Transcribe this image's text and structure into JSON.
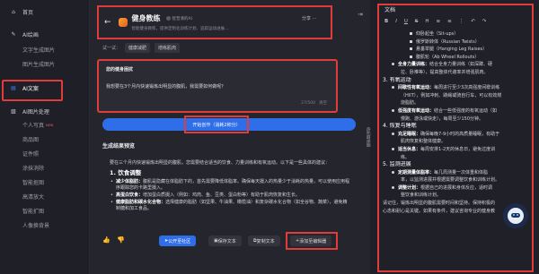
{
  "sidebar": {
    "items": [
      {
        "label": "首页",
        "icon": "home-icon",
        "sub": false
      },
      {
        "label": "AI绘画",
        "icon": "paint-icon",
        "sub": false
      },
      {
        "label": "文字生成图片",
        "sub": true
      },
      {
        "label": "图片生成图片",
        "sub": true
      },
      {
        "label": "AI文案",
        "icon": "document-icon",
        "sub": false,
        "active": true
      },
      {
        "label": "AI图片处理",
        "icon": "image-icon",
        "sub": false
      },
      {
        "label": "个人写真",
        "sub": true,
        "badge": "NEW"
      },
      {
        "label": "商品图",
        "sub": true
      },
      {
        "label": "证件照",
        "sub": true
      },
      {
        "label": "涂抹消除",
        "sub": true
      },
      {
        "label": "智能抠图",
        "sub": true
      },
      {
        "label": "高清放大",
        "sub": true
      },
      {
        "label": "智能扩图",
        "sub": true
      },
      {
        "label": "人像换背景",
        "sub": true
      }
    ]
  },
  "header": {
    "title": "健身教练",
    "tag": "智普清的AI",
    "description": "智能健身教练，提供定制化训练计划、追踪运动进展…",
    "share_label": "分享"
  },
  "try": {
    "label": "试一试：",
    "chips": [
      "健康减肥",
      "增练肌肉"
    ]
  },
  "input": {
    "label": "您的健身困扰",
    "value": "我想要在3个月内快速锻炼出明显的腹肌，我需要如何做呢？",
    "counter": "27/500",
    "stop": "清空"
  },
  "cta": {
    "label": "开始创作（消耗2积分）"
  },
  "result": {
    "title": "生成结果预览",
    "intro": "要在三个月内快速锻炼出明显的腹肌，您需要结合适当的饮食、力量训练和有氧运动。以下是一些具体的建议：",
    "heading": "1. 饮食调整",
    "bullets": [
      {
        "b": "减少体脂肪：",
        "t": "腹肌是隐藏在体脂肪下的，首先需要降低体脂率。确保每天摄入的热量少于消耗的热量，可以使用应用程序跟踪您的卡路里摄入。"
      },
      {
        "b": "高蛋白饮食：",
        "t": "增加蛋白质摄入（例如：鸡肉、鱼、豆类、蛋白粉等）有助于肌肉恢复和生长。"
      },
      {
        "b": "健康脂肪和碳水化合物：",
        "t": "选择健康的脂肪（如坚果、牛油果、橄榄油）和复杂碳水化合物（如全谷物、蔬菜），避免精制糖和加工食品。"
      }
    ]
  },
  "actions": {
    "publish": "公开至社区",
    "save": "保存文本",
    "copy": "复制文本",
    "add_editor": "添加至编辑器"
  },
  "strip_label": "收起编辑器",
  "doc": {
    "title": "文档",
    "toolbar": [
      "B",
      "I",
      "U",
      "S",
      "H",
      "≡",
      "≡",
      "⋮",
      "↶",
      "↷"
    ],
    "lines": [
      {
        "t": "仰卧起坐（Sit-ups）",
        "ind": 3,
        "mark": "sq"
      },
      {
        "t": "俄罗斯转体（Russian Twists）",
        "ind": 3,
        "mark": "sq"
      },
      {
        "t": "悬垂举腿（Hanging Leg Raises）",
        "ind": 3,
        "mark": "sq"
      },
      {
        "t": "腹肌轮（Ab Wheel Rollouts）",
        "ind": 3,
        "mark": "sq"
      },
      {
        "b": "全身力量训练：",
        "t": "结合全身力量训练（如深蹲、硬",
        "ind": 1,
        "mark": "dt"
      },
      {
        "t": "拉、卧推等），提高整体代谢率并增强肌肉。",
        "ind": 2
      },
      {
        "t": "3. 有氧运动",
        "ind": 0,
        "h": true
      },
      {
        "b": "间歇性有氧运动：",
        "t": "每周进行至少3次高强度间歇训练",
        "ind": 1,
        "mark": "dt"
      },
      {
        "t": "（HIIT），例如冲刺、跳绳或骑自行车，可以有效燃",
        "ind": 2
      },
      {
        "t": "烧脂肪。",
        "ind": 2
      },
      {
        "b": "低强度有氧运动：",
        "t": "结合一些低强度的有氧运动（如",
        "ind": 1,
        "mark": "dt"
      },
      {
        "t": "慢跑、游泳或快走），每周至少150分钟。",
        "ind": 2
      },
      {
        "t": "4. 恢复与睡眠",
        "ind": 0,
        "h": true
      },
      {
        "b": "充足睡眠：",
        "t": "确保每晚7-9小时的高质量睡眠，有助于",
        "ind": 1,
        "mark": "dt"
      },
      {
        "t": "肌肉恢复和整体健康。",
        "ind": 2
      },
      {
        "b": "适当休息：",
        "t": "每周安排1-2天的休息日，避免过度训",
        "ind": 1,
        "mark": "dt"
      },
      {
        "t": "练。",
        "ind": 2
      },
      {
        "t": "5. 监测进展",
        "ind": 0,
        "h": true
      },
      {
        "b": "定期测量体脂率：",
        "t": "每几周测量一次体重和体脂",
        "ind": 1,
        "mark": "dt"
      },
      {
        "t": "率，以监测进展并根据需要调整饮食和训练计划。",
        "ind": 2
      },
      {
        "b": "调整计划：",
        "t": "根据自己的进展和身体反应，适时调",
        "ind": 1,
        "mark": "dt"
      },
      {
        "t": "整饮食和训练计划。",
        "ind": 2
      },
      {
        "t": "请记住，锻炼出明显的腹肌需要时间和坚持。保持积极的",
        "ind": 0
      },
      {
        "t": "心态和耐心是关键。如果有条件，建议咨询专业的健身教",
        "ind": 0
      }
    ]
  }
}
